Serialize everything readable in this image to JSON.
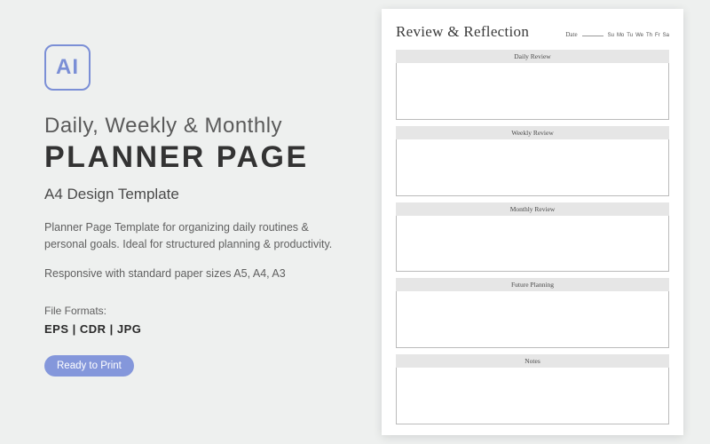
{
  "left": {
    "logo": "AI",
    "heading_line1": "Daily, Weekly & Monthly",
    "heading_line2": "PLANNER PAGE",
    "subtitle": "A4 Design Template",
    "description": "Planner Page Template for organizing daily routines & personal goals. Ideal for structured planning & productivity.",
    "responsive_note": "Responsive with standard paper sizes A5, A4, A3",
    "file_formats_label": "File Formats:",
    "file_formats_value": "EPS  |  CDR  |  JPG",
    "badge": "Ready to Print"
  },
  "page": {
    "title": "Review & Reflection",
    "date_label": "Date",
    "days": [
      "Su",
      "Mo",
      "Tu",
      "We",
      "Th",
      "Fr",
      "Sa"
    ],
    "sections": [
      "Daily Review",
      "Weekly Review",
      "Monthly Review",
      "Future Planning",
      "Notes"
    ]
  }
}
